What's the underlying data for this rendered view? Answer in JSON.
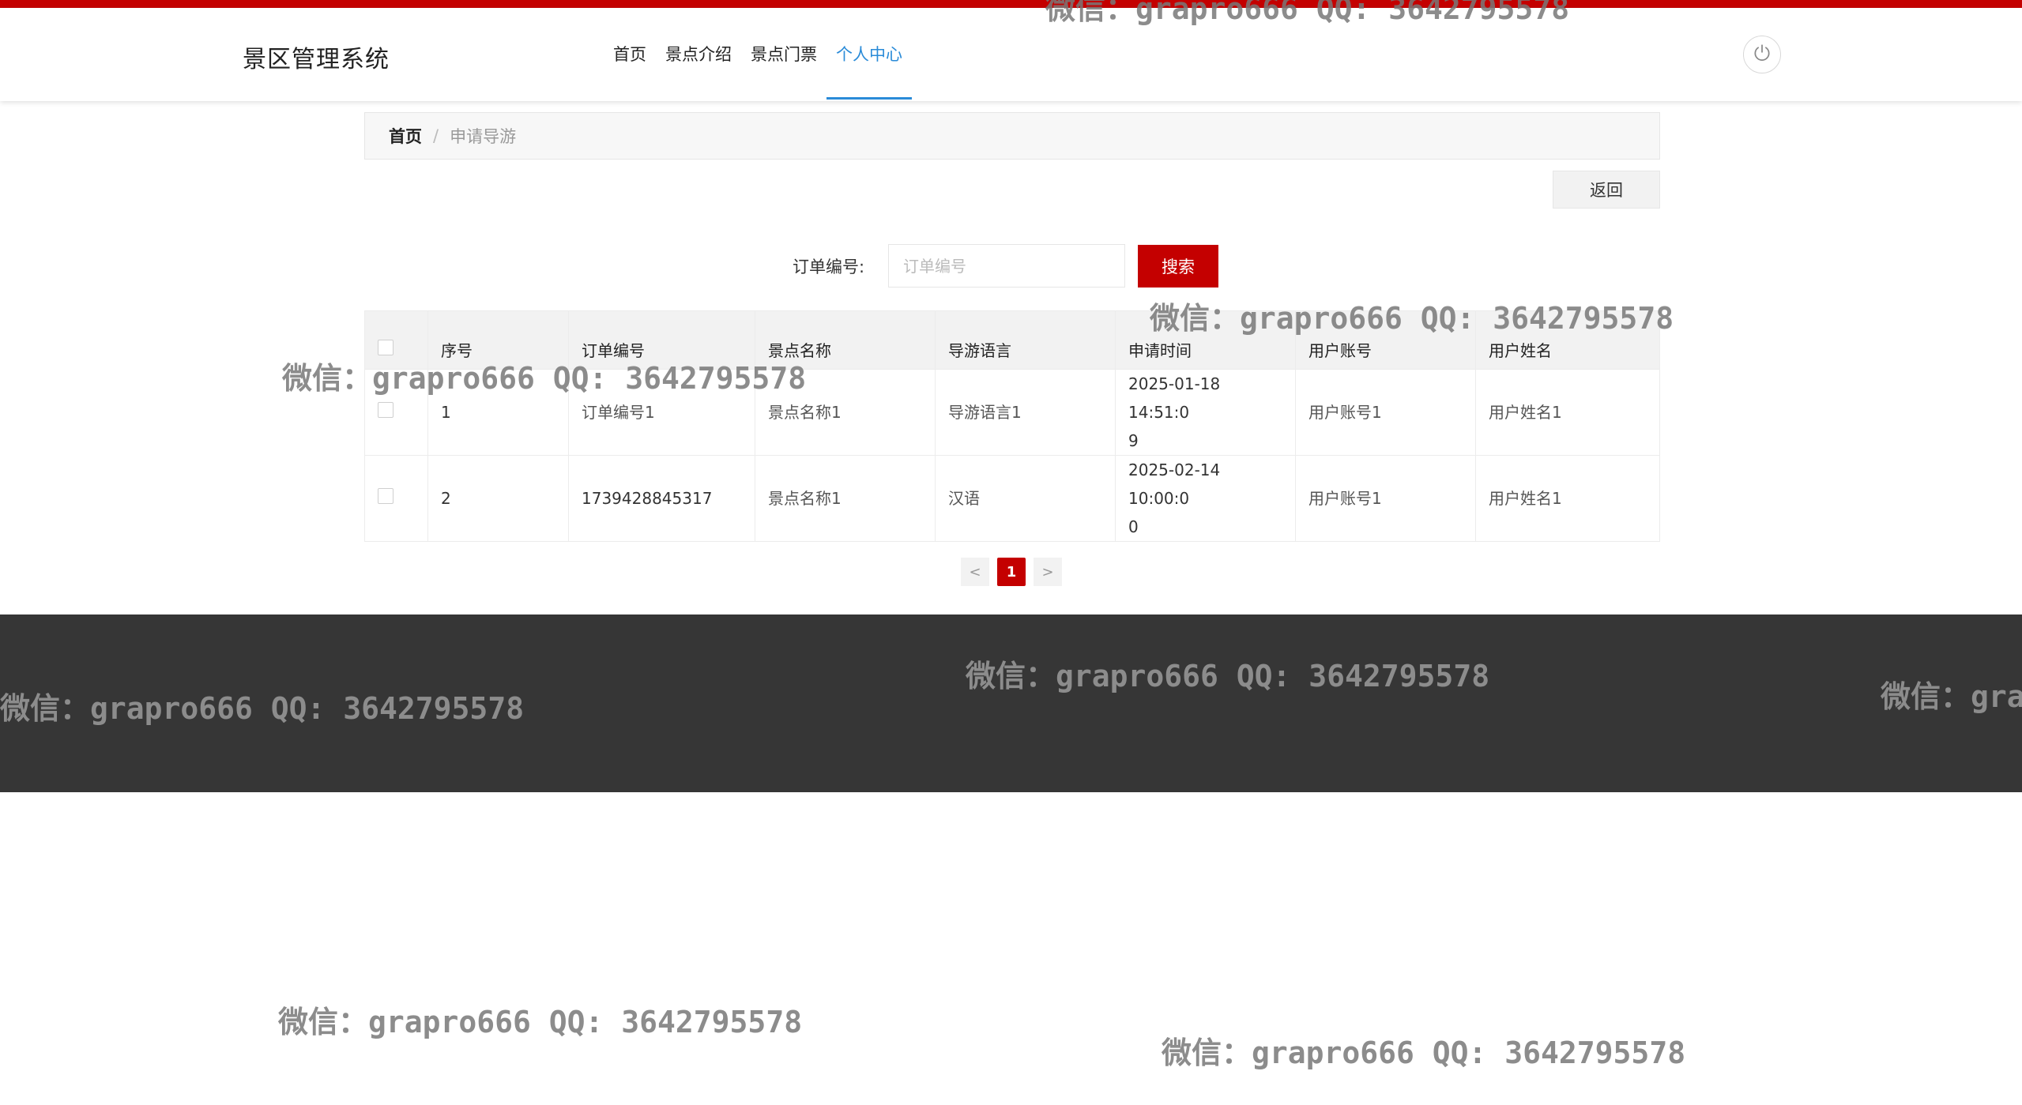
{
  "app": {
    "title": "景区管理系统"
  },
  "nav": {
    "items": [
      {
        "label": "首页"
      },
      {
        "label": "景点介绍"
      },
      {
        "label": "景点门票"
      },
      {
        "label": "个人中心",
        "active": true
      }
    ]
  },
  "breadcrumb": {
    "home": "首页",
    "separator": "/",
    "current": "申请导游"
  },
  "back_button": {
    "label": "返回"
  },
  "search": {
    "label": "订单编号:",
    "placeholder": "订单编号",
    "value": "",
    "button": "搜索"
  },
  "table": {
    "columns": [
      "序号",
      "订单编号",
      "景点名称",
      "导游语言",
      "申请时间",
      "用户账号",
      "用户姓名"
    ],
    "rows": [
      {
        "index": "1",
        "order_no": "订单编号1",
        "spot": "景点名称1",
        "language": "导游语言1",
        "time_line1": "2025-01-18 14:51:0",
        "time_line2": "9",
        "account": "用户账号1",
        "name": "用户姓名1"
      },
      {
        "index": "2",
        "order_no": "1739428845317",
        "spot": "景点名称1",
        "language": "汉语",
        "time_line1": "2025-02-14 10:00:0",
        "time_line2": "0",
        "account": "用户账号1",
        "name": "用户姓名1"
      }
    ]
  },
  "pagination": {
    "prev": "<",
    "current": "1",
    "next": ">"
  },
  "watermark": {
    "text": "微信：grapro666 QQ: 3642795578"
  },
  "colors": {
    "accent": "#c40000",
    "nav_active": "#2a8bd8",
    "footer": "#363636"
  },
  "icons": {
    "logout": "power-icon"
  }
}
